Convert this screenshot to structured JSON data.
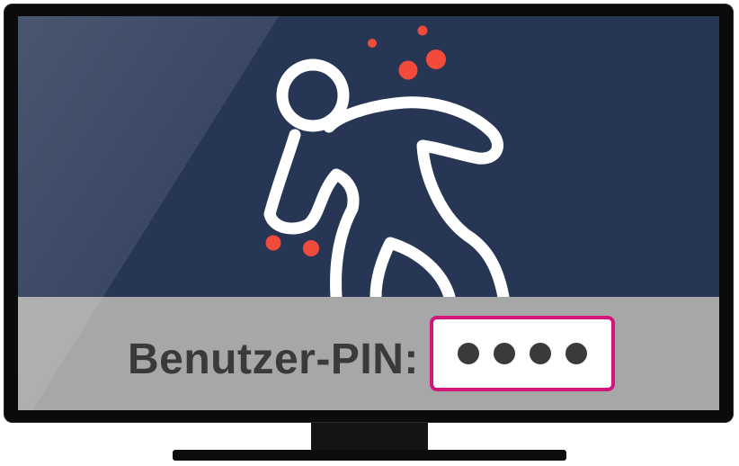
{
  "pin_prompt": {
    "label": "Benutzer-PIN:",
    "masked_digits": 4
  },
  "icons": {
    "illustration": "chalk-outline-body-icon",
    "blood_spots": "blood-drop-icon"
  },
  "colors": {
    "screen_background": "#273655",
    "pin_bar": "#a7a7a7",
    "pin_border_accent": "#d4157c",
    "outline": "#ffffff",
    "blood": "#f24b3c",
    "label_text": "#3a3a3a",
    "bezel": "#0b0b0b"
  }
}
